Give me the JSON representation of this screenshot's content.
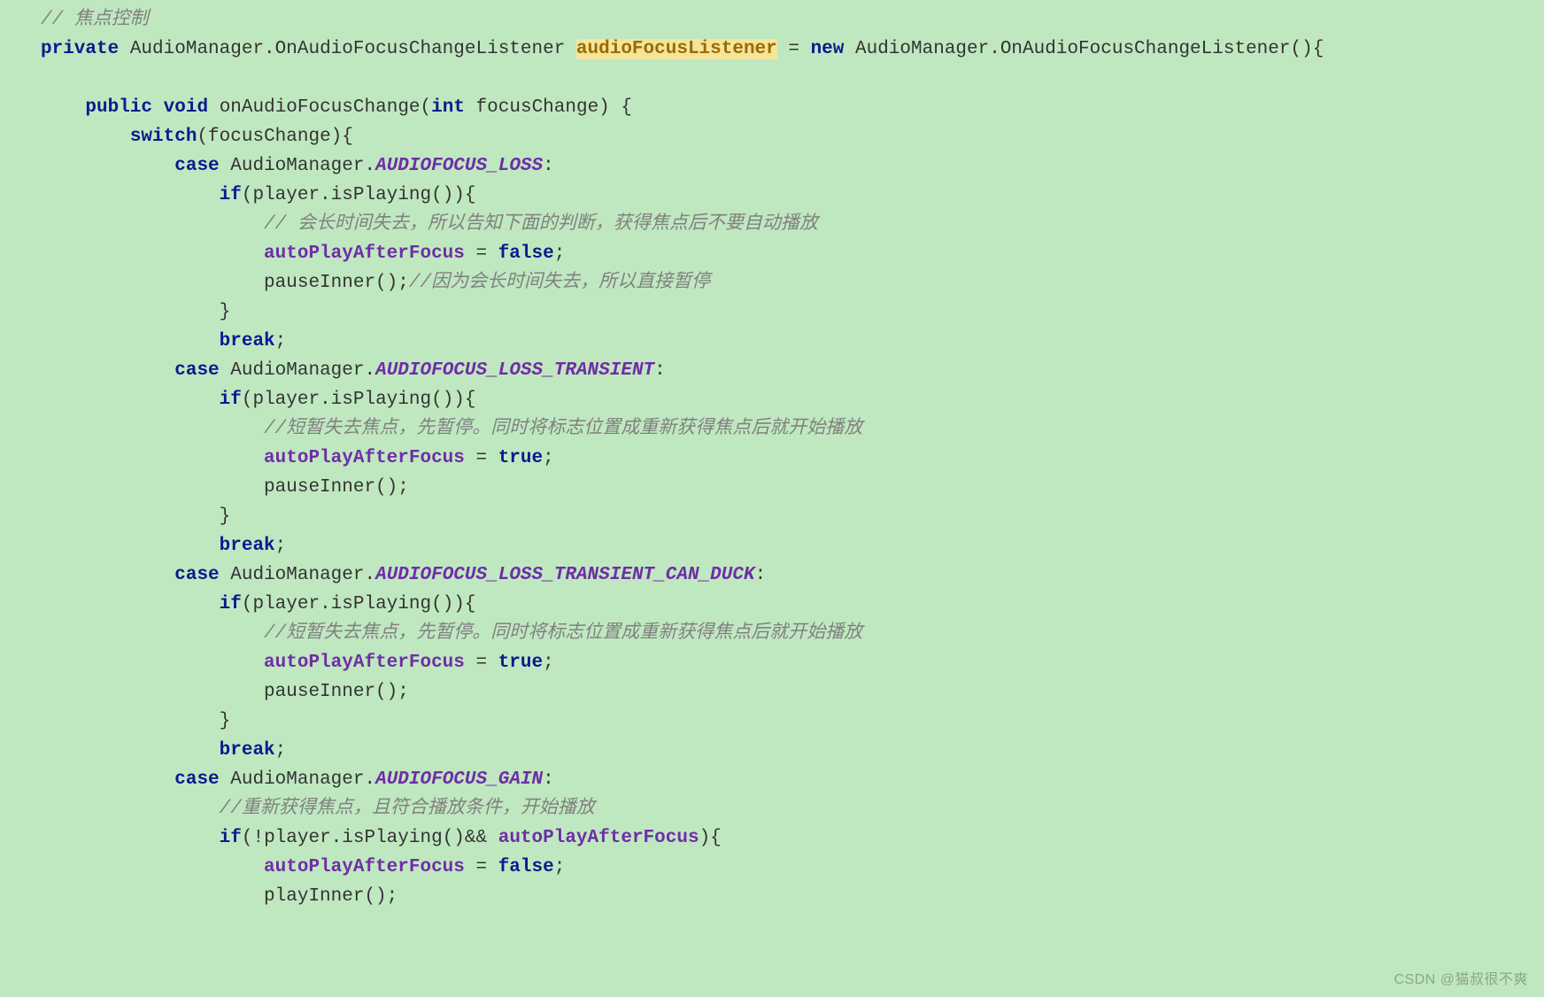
{
  "tokens": [
    {
      "cls": "cm",
      "t": "// 焦点控制"
    },
    {
      "cls": "pt",
      "t": "\n"
    },
    {
      "cls": "kw",
      "t": "private"
    },
    {
      "cls": "pt",
      "t": " "
    },
    {
      "cls": "ty",
      "t": "AudioManager.OnAudioFocusChangeListener"
    },
    {
      "cls": "pt",
      "t": " "
    },
    {
      "cls": "hl",
      "t": "audioFocusListener"
    },
    {
      "cls": "pt",
      "t": " = "
    },
    {
      "cls": "kw",
      "t": "new"
    },
    {
      "cls": "pt",
      "t": " "
    },
    {
      "cls": "ty",
      "t": "AudioManager.OnAudioFocusChangeListener"
    },
    {
      "cls": "pt",
      "t": "(){"
    },
    {
      "cls": "pt",
      "t": "\n"
    },
    {
      "cls": "pt",
      "t": "\n"
    },
    {
      "cls": "pt",
      "t": "    "
    },
    {
      "cls": "kw",
      "t": "public"
    },
    {
      "cls": "pt",
      "t": " "
    },
    {
      "cls": "kw",
      "t": "void"
    },
    {
      "cls": "pt",
      "t": " "
    },
    {
      "cls": "ty",
      "t": "onAudioFocusChange"
    },
    {
      "cls": "pt",
      "t": "("
    },
    {
      "cls": "kw",
      "t": "int"
    },
    {
      "cls": "pt",
      "t": " focusChange) {"
    },
    {
      "cls": "pt",
      "t": "\n"
    },
    {
      "cls": "pt",
      "t": "        "
    },
    {
      "cls": "kw",
      "t": "switch"
    },
    {
      "cls": "pt",
      "t": "(focusChange){"
    },
    {
      "cls": "pt",
      "t": "\n"
    },
    {
      "cls": "pt",
      "t": "            "
    },
    {
      "cls": "kw",
      "t": "case"
    },
    {
      "cls": "pt",
      "t": " AudioManager."
    },
    {
      "cls": "const",
      "t": "AUDIOFOCUS_LOSS"
    },
    {
      "cls": "pt",
      "t": ":"
    },
    {
      "cls": "pt",
      "t": "\n"
    },
    {
      "cls": "pt",
      "t": "                "
    },
    {
      "cls": "kw",
      "t": "if"
    },
    {
      "cls": "pt",
      "t": "(player.isPlaying()){"
    },
    {
      "cls": "pt",
      "t": "\n"
    },
    {
      "cls": "pt",
      "t": "                    "
    },
    {
      "cls": "cm",
      "t": "// 会长时间失去，所以告知下面的判断，获得焦点后不要自动播放"
    },
    {
      "cls": "pt",
      "t": "\n"
    },
    {
      "cls": "pt",
      "t": "                    "
    },
    {
      "cls": "fld",
      "t": "autoPlayAfterFocus"
    },
    {
      "cls": "pt",
      "t": " = "
    },
    {
      "cls": "bool",
      "t": "false"
    },
    {
      "cls": "pt",
      "t": ";"
    },
    {
      "cls": "pt",
      "t": "\n"
    },
    {
      "cls": "pt",
      "t": "                    pauseInner();"
    },
    {
      "cls": "cm",
      "t": "//因为会长时间失去，所以直接暂停"
    },
    {
      "cls": "pt",
      "t": "\n"
    },
    {
      "cls": "pt",
      "t": "                }"
    },
    {
      "cls": "pt",
      "t": "\n"
    },
    {
      "cls": "pt",
      "t": "                "
    },
    {
      "cls": "kw",
      "t": "break"
    },
    {
      "cls": "pt",
      "t": ";"
    },
    {
      "cls": "pt",
      "t": "\n"
    },
    {
      "cls": "pt",
      "t": "            "
    },
    {
      "cls": "kw",
      "t": "case"
    },
    {
      "cls": "pt",
      "t": " AudioManager."
    },
    {
      "cls": "const",
      "t": "AUDIOFOCUS_LOSS_TRANSIENT"
    },
    {
      "cls": "pt",
      "t": ":"
    },
    {
      "cls": "pt",
      "t": "\n"
    },
    {
      "cls": "pt",
      "t": "                "
    },
    {
      "cls": "kw",
      "t": "if"
    },
    {
      "cls": "pt",
      "t": "(player.isPlaying()){"
    },
    {
      "cls": "pt",
      "t": "\n"
    },
    {
      "cls": "pt",
      "t": "                    "
    },
    {
      "cls": "cm",
      "t": "//短暂失去焦点，先暂停。同时将标志位置成重新获得焦点后就开始播放"
    },
    {
      "cls": "pt",
      "t": "\n"
    },
    {
      "cls": "pt",
      "t": "                    "
    },
    {
      "cls": "fld",
      "t": "autoPlayAfterFocus"
    },
    {
      "cls": "pt",
      "t": " = "
    },
    {
      "cls": "bool",
      "t": "true"
    },
    {
      "cls": "pt",
      "t": ";"
    },
    {
      "cls": "pt",
      "t": "\n"
    },
    {
      "cls": "pt",
      "t": "                    pauseInner();"
    },
    {
      "cls": "pt",
      "t": "\n"
    },
    {
      "cls": "pt",
      "t": "                }"
    },
    {
      "cls": "pt",
      "t": "\n"
    },
    {
      "cls": "pt",
      "t": "                "
    },
    {
      "cls": "kw",
      "t": "break"
    },
    {
      "cls": "pt",
      "t": ";"
    },
    {
      "cls": "pt",
      "t": "\n"
    },
    {
      "cls": "pt",
      "t": "            "
    },
    {
      "cls": "kw",
      "t": "case"
    },
    {
      "cls": "pt",
      "t": " AudioManager."
    },
    {
      "cls": "const",
      "t": "AUDIOFOCUS_LOSS_TRANSIENT_CAN_DUCK"
    },
    {
      "cls": "pt",
      "t": ":"
    },
    {
      "cls": "pt",
      "t": "\n"
    },
    {
      "cls": "pt",
      "t": "                "
    },
    {
      "cls": "kw",
      "t": "if"
    },
    {
      "cls": "pt",
      "t": "(player.isPlaying()){"
    },
    {
      "cls": "pt",
      "t": "\n"
    },
    {
      "cls": "pt",
      "t": "                    "
    },
    {
      "cls": "cm",
      "t": "//短暂失去焦点，先暂停。同时将标志位置成重新获得焦点后就开始播放"
    },
    {
      "cls": "pt",
      "t": "\n"
    },
    {
      "cls": "pt",
      "t": "                    "
    },
    {
      "cls": "fld",
      "t": "autoPlayAfterFocus"
    },
    {
      "cls": "pt",
      "t": " = "
    },
    {
      "cls": "bool",
      "t": "true"
    },
    {
      "cls": "pt",
      "t": ";"
    },
    {
      "cls": "pt",
      "t": "\n"
    },
    {
      "cls": "pt",
      "t": "                    pauseInner();"
    },
    {
      "cls": "pt",
      "t": "\n"
    },
    {
      "cls": "pt",
      "t": "                }"
    },
    {
      "cls": "pt",
      "t": "\n"
    },
    {
      "cls": "pt",
      "t": "                "
    },
    {
      "cls": "kw",
      "t": "break"
    },
    {
      "cls": "pt",
      "t": ";"
    },
    {
      "cls": "pt",
      "t": "\n"
    },
    {
      "cls": "pt",
      "t": "            "
    },
    {
      "cls": "kw",
      "t": "case"
    },
    {
      "cls": "pt",
      "t": " AudioManager."
    },
    {
      "cls": "const",
      "t": "AUDIOFOCUS_GAIN"
    },
    {
      "cls": "pt",
      "t": ":"
    },
    {
      "cls": "pt",
      "t": "\n"
    },
    {
      "cls": "pt",
      "t": "                "
    },
    {
      "cls": "cm",
      "t": "//重新获得焦点，且符合播放条件，开始播放"
    },
    {
      "cls": "pt",
      "t": "\n"
    },
    {
      "cls": "pt",
      "t": "                "
    },
    {
      "cls": "kw",
      "t": "if"
    },
    {
      "cls": "pt",
      "t": "(!player.isPlaying()&& "
    },
    {
      "cls": "fld",
      "t": "autoPlayAfterFocus"
    },
    {
      "cls": "pt",
      "t": "){"
    },
    {
      "cls": "pt",
      "t": "\n"
    },
    {
      "cls": "pt",
      "t": "                    "
    },
    {
      "cls": "fld",
      "t": "autoPlayAfterFocus"
    },
    {
      "cls": "pt",
      "t": " = "
    },
    {
      "cls": "bool",
      "t": "false"
    },
    {
      "cls": "pt",
      "t": ";"
    },
    {
      "cls": "pt",
      "t": "\n"
    },
    {
      "cls": "pt",
      "t": "                    playInner();"
    }
  ],
  "watermark": "CSDN @猫叔很不爽"
}
